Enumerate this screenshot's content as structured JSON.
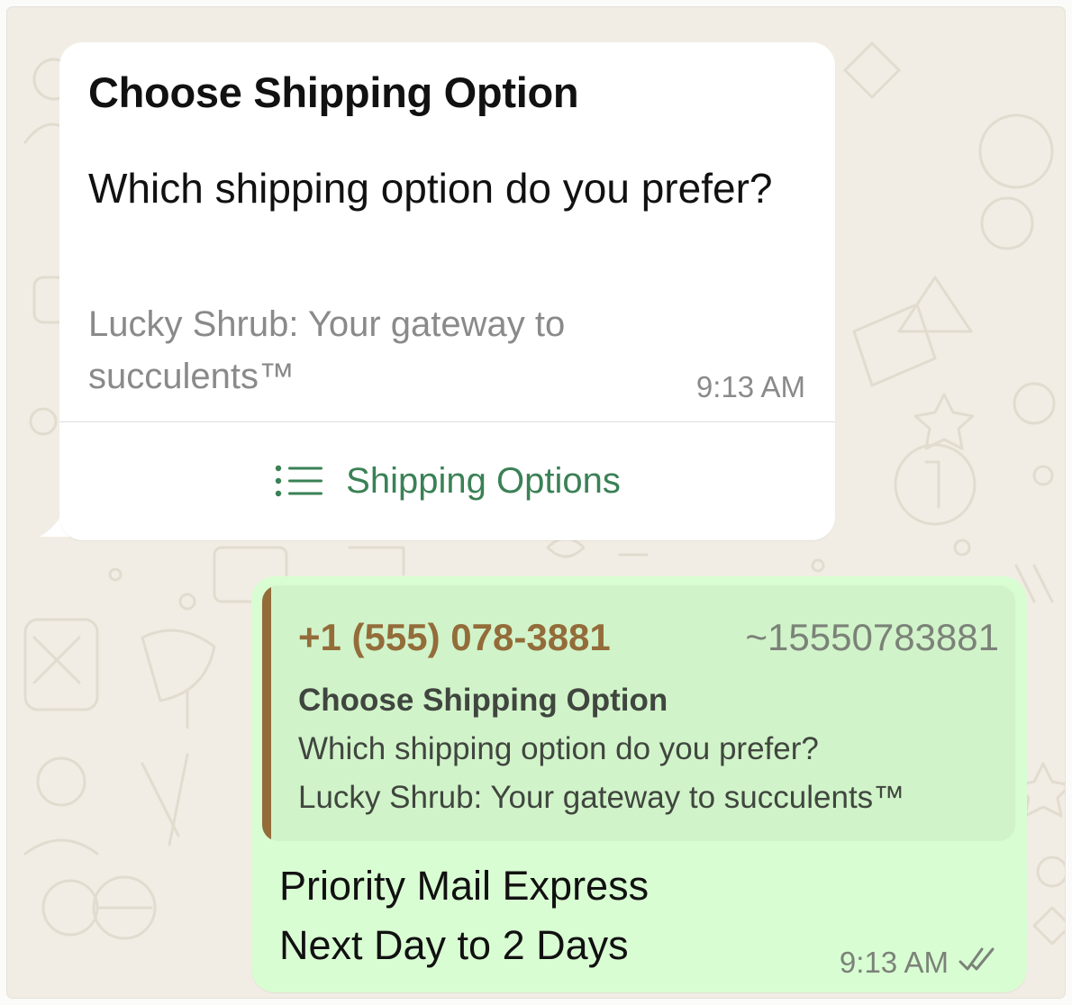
{
  "colors": {
    "chat_background": "#f1ede4",
    "incoming_bubble": "#ffffff",
    "outgoing_bubble": "#d9fdd3",
    "quote_background": "#d1f3c9",
    "quote_accent": "#936c3a",
    "action_green": "#3a8156",
    "meta_gray": "#8a8a8a"
  },
  "incoming": {
    "title": "Choose Shipping Option",
    "body": "Which shipping option do you prefer?",
    "footer": "Lucky Shrub: Your gateway to succulents™",
    "time": "9:13 AM",
    "button_label": "Shipping Options",
    "button_icon": "list-icon"
  },
  "outgoing": {
    "quote": {
      "sender_phone": "+1 (555) 078-3881",
      "sender_pushname": "~15550783881",
      "title": "Choose Shipping Option",
      "body": "Which shipping option do you prefer?",
      "footer": "Lucky Shrub: Your gateway to succulents™"
    },
    "reply_title": "Priority Mail Express",
    "reply_description": "Next Day to 2 Days",
    "time": "9:13 AM",
    "status_icon": "double-check-read-icon"
  }
}
